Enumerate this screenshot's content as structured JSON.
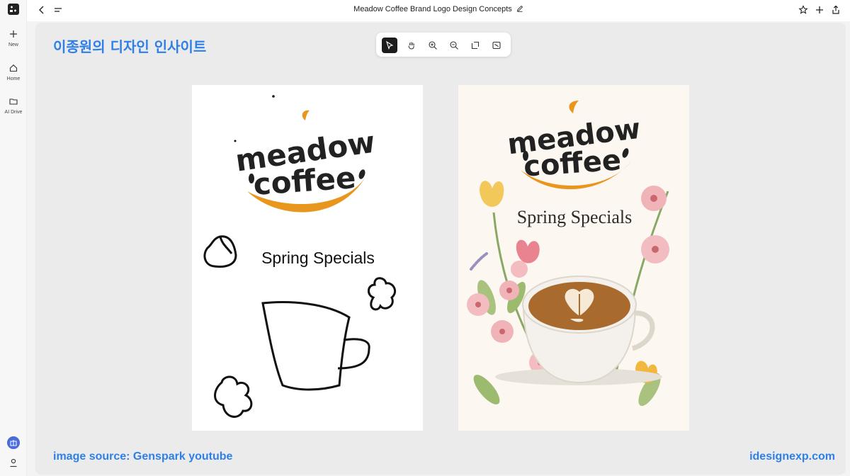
{
  "app": {
    "sidebar": {
      "items": [
        {
          "label": "New",
          "icon": "plus-icon"
        },
        {
          "label": "Home",
          "icon": "home-icon"
        },
        {
          "label": "AI Drive",
          "icon": "folder-icon"
        }
      ]
    },
    "topbar": {
      "title": "Meadow Coffee Brand Logo Design Concepts"
    }
  },
  "overlay": {
    "title": "이종원의 디자인 인사이트",
    "source_credit": "image source: Genspark youtube",
    "site": "idesignexp.com"
  },
  "toolbar": {
    "tools": [
      "select-tool",
      "pan-tool",
      "zoom-in-tool",
      "zoom-out-tool",
      "frame-tool",
      "fit-tool"
    ],
    "active": "select-tool"
  },
  "canvas": {
    "sketch_card": {
      "logo_line1": "meadow",
      "logo_line2": "coffee",
      "headline": "Spring Specials"
    },
    "render_card": {
      "logo_line1": "meadow",
      "logo_line2": "coffee",
      "headline": "Spring Specials"
    }
  },
  "colors": {
    "accent_blue": "#2f7fe8",
    "logo_orange": "#e8961e",
    "sidebar_badge": "#4a6bd8"
  }
}
